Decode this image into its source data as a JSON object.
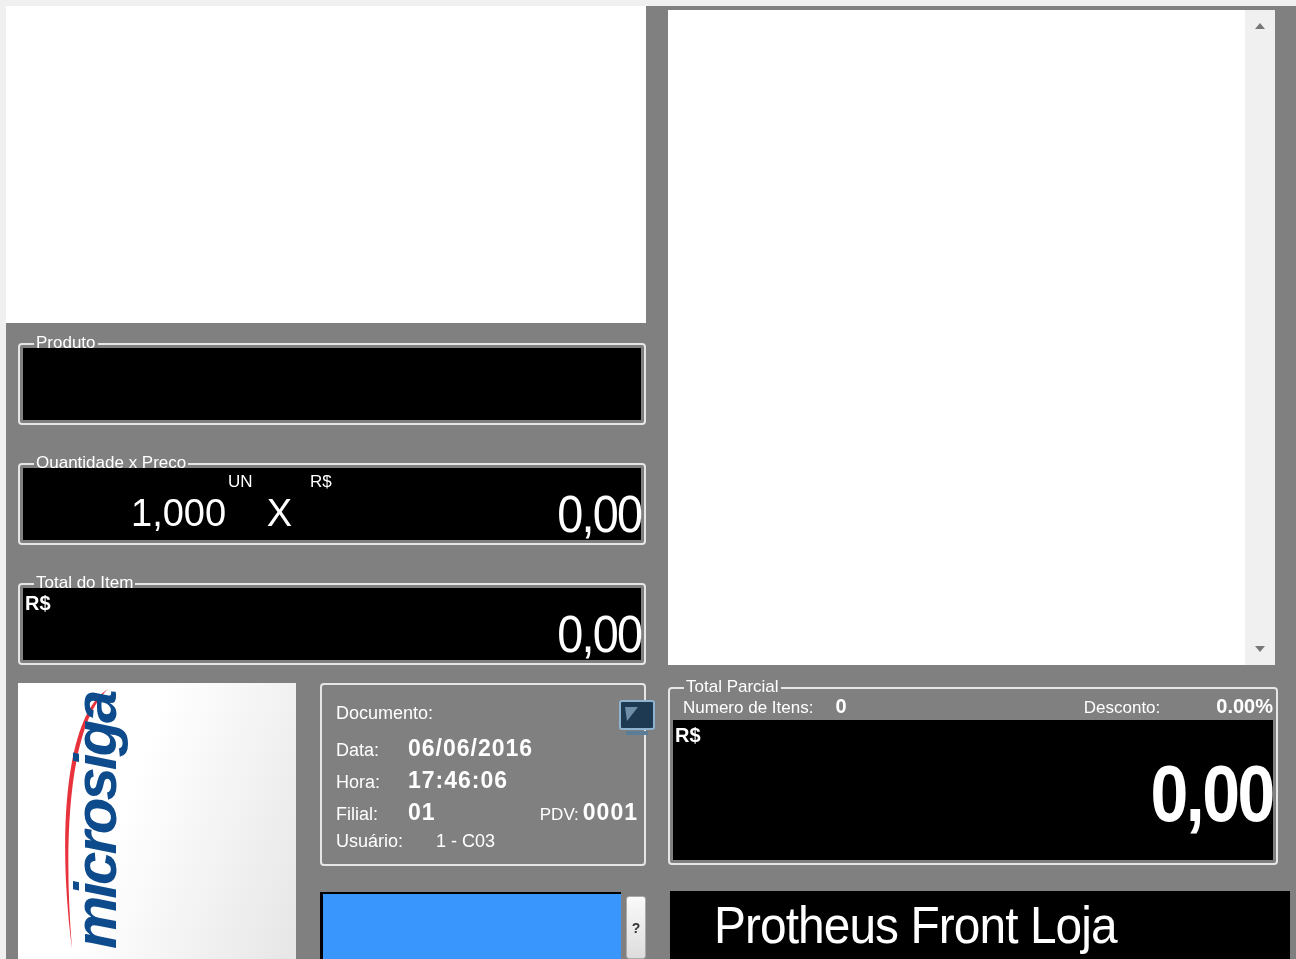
{
  "product": {
    "label": "Produto"
  },
  "quantity_price": {
    "label": "Quantidade x Preco",
    "quantity": "1,000",
    "unit": "UN",
    "times": "X",
    "currency": "R$",
    "price": "0,00"
  },
  "item_total": {
    "label": "Total do Item",
    "currency": "R$",
    "value": "0,00"
  },
  "logo": {
    "text": "microsiga"
  },
  "document_info": {
    "rows": [
      {
        "label": "Documento:"
      },
      {
        "label": "Data:",
        "value": "06/06/2016",
        "emphasis": true
      },
      {
        "label": "Hora:",
        "value": "17:46:06",
        "emphasis": true
      },
      {
        "label": "Filial:",
        "value": "01",
        "emphasis": true,
        "extra": {
          "label": "PDV:",
          "value": "0001"
        }
      },
      {
        "label": "Usuário:",
        "value": "1 - C03",
        "emphasis": false
      }
    ]
  },
  "help_button": {
    "label": "?"
  },
  "partial_total": {
    "label": "Total Parcial",
    "items_label": "Numero de Itens:",
    "items_value": "0",
    "discount_label": "Desconto:",
    "discount_value": "0.00%",
    "currency": "R$",
    "value": "0,00"
  },
  "banner": {
    "text": "Protheus Front Loja"
  }
}
